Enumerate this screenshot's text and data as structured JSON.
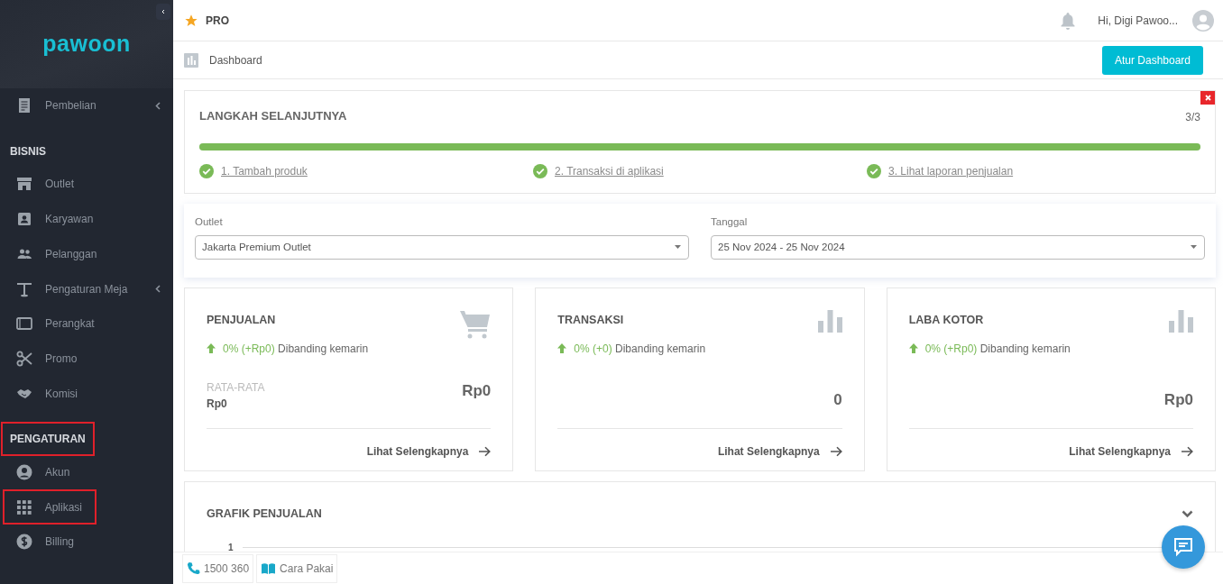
{
  "sidebar": {
    "logo": "pawoon",
    "entries": [
      {
        "kind": "item",
        "label": "Pembelian",
        "has_submenu": true,
        "highlighted": false
      },
      {
        "kind": "header",
        "label": "BISNIS",
        "highlighted": false
      },
      {
        "kind": "item",
        "label": "Outlet",
        "has_submenu": false,
        "highlighted": false
      },
      {
        "kind": "item",
        "label": "Karyawan",
        "has_submenu": false,
        "highlighted": false
      },
      {
        "kind": "item",
        "label": "Pelanggan",
        "has_submenu": false,
        "highlighted": false
      },
      {
        "kind": "item",
        "label": "Pengaturan Meja",
        "has_submenu": true,
        "highlighted": false
      },
      {
        "kind": "item",
        "label": "Perangkat",
        "has_submenu": false,
        "highlighted": false
      },
      {
        "kind": "item",
        "label": "Promo",
        "has_submenu": false,
        "highlighted": false
      },
      {
        "kind": "item",
        "label": "Komisi",
        "has_submenu": false,
        "highlighted": false
      },
      {
        "kind": "header",
        "label": "PENGATURAN",
        "highlighted": true
      },
      {
        "kind": "item",
        "label": "Akun",
        "has_submenu": false,
        "highlighted": false
      },
      {
        "kind": "item",
        "label": "Aplikasi",
        "has_submenu": false,
        "highlighted": true
      },
      {
        "kind": "item",
        "label": "Billing",
        "has_submenu": false,
        "highlighted": false
      }
    ]
  },
  "topbar": {
    "plan": "PRO",
    "greeting": "Hi, Digi Pawoo..."
  },
  "page_header": {
    "title": "Dashboard",
    "button": "Atur Dashboard"
  },
  "steps_card": {
    "title": "LANGKAH SELANJUTNYA",
    "counter": "3/3",
    "level": 1.0,
    "steps": [
      {
        "label": "1. Tambah produk",
        "done": true
      },
      {
        "label": "2. Transaksi di aplikasi",
        "done": true
      },
      {
        "label": "3. Lihat laporan penjualan",
        "done": true
      }
    ]
  },
  "filters": [
    {
      "label": "Outlet",
      "value": "Jakarta Premium Outlet"
    },
    {
      "label": "Tanggal",
      "value": "25 Nov 2024 - 25 Nov 2024"
    }
  ],
  "stats": [
    {
      "kind": "cart",
      "title": "PENJUALAN",
      "change": "0% (+Rp0)",
      "note": "Dibanding kemarin",
      "avg_label": "RATA-RATA",
      "avg_value": "Rp0",
      "value": "Rp0",
      "link": "Lihat Selengkapnya"
    },
    {
      "kind": "bars",
      "title": "TRANSAKSI",
      "change": "0% (+0)",
      "note": "Dibanding kemarin",
      "value": "0",
      "link": "Lihat Selengkapnya"
    },
    {
      "kind": "bars",
      "title": "LABA KOTOR",
      "change": "0% (+Rp0)",
      "note": "Dibanding kemarin",
      "value": "Rp0",
      "link": "Lihat Selengkapnya"
    }
  ],
  "chart_card": {
    "title": "GRAFIK PENJUALAN",
    "expanded": false,
    "y_tick": "1"
  },
  "footer": {
    "phone": "1500 360",
    "guide": "Cara Pakai"
  }
}
